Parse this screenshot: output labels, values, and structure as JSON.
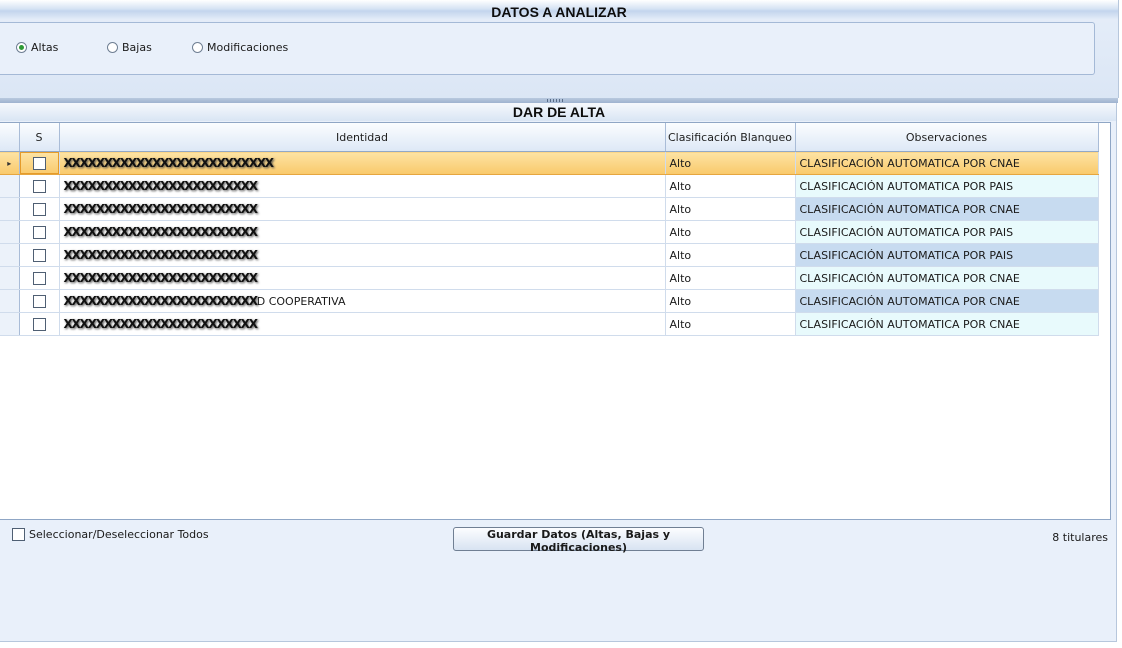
{
  "analyze_section": {
    "title": "DATOS A ANALIZAR",
    "options": [
      {
        "label": "Altas",
        "selected": true
      },
      {
        "label": "Bajas",
        "selected": false
      },
      {
        "label": "Modificaciones",
        "selected": false
      }
    ]
  },
  "grid_section": {
    "title": "DAR DE ALTA",
    "columns": {
      "select": "S",
      "identity": "Identidad",
      "classification": "Clasificación Blanqueo",
      "observations": "Observaciones"
    },
    "rows": [
      {
        "identity": "XXXXXXXXXXXXXXXXXXXXXXXXXX",
        "classification": "Alto",
        "observations": "CLASIFICACIÓN AUTOMATICA POR CNAE"
      },
      {
        "identity": "XXXXXXXXXXXXXXXXXXXXXXXX",
        "classification": "Alto",
        "observations": "CLASIFICACIÓN AUTOMATICA POR PAIS"
      },
      {
        "identity": "XXXXXXXXXXXXXXXXXXXXXXXX",
        "classification": "Alto",
        "observations": "CLASIFICACIÓN AUTOMATICA POR CNAE"
      },
      {
        "identity": "XXXXXXXXXXXXXXXXXXXXXXXX",
        "classification": "Alto",
        "observations": "CLASIFICACIÓN AUTOMATICA POR PAIS"
      },
      {
        "identity": "XXXXXXXXXXXXXXXXXXXXXXXX",
        "classification": "Alto",
        "observations": "CLASIFICACIÓN AUTOMATICA POR PAIS"
      },
      {
        "identity": "XXXXXXXXXXXXXXXXXXXXXXXX",
        "classification": "Alto",
        "observations": "CLASIFICACIÓN AUTOMATICA POR CNAE"
      },
      {
        "identity": "XXXXXXXXXXXXXXXXXXXXXXXX",
        "identity_suffix": "D COOPERATIVA",
        "classification": "Alto",
        "observations": "CLASIFICACIÓN AUTOMATICA POR CNAE"
      },
      {
        "identity": "XXXXXXXXXXXXXXXXXXXXXXXX",
        "classification": "Alto",
        "observations": "CLASIFICACIÓN AUTOMATICA POR CNAE"
      }
    ],
    "current_row_marker": "▸"
  },
  "footer": {
    "select_all_label": "Seleccionar/Deseleccionar Todos",
    "save_button_label": "Guardar Datos (Altas, Bajas y Modificaciones)",
    "count_label": "8 titulares"
  },
  "colors": {
    "selected_row": "#f9c96b",
    "observations_alt": "#c7dbf0",
    "observations": "#e8fafc",
    "radio_on": "#2e9a35"
  }
}
